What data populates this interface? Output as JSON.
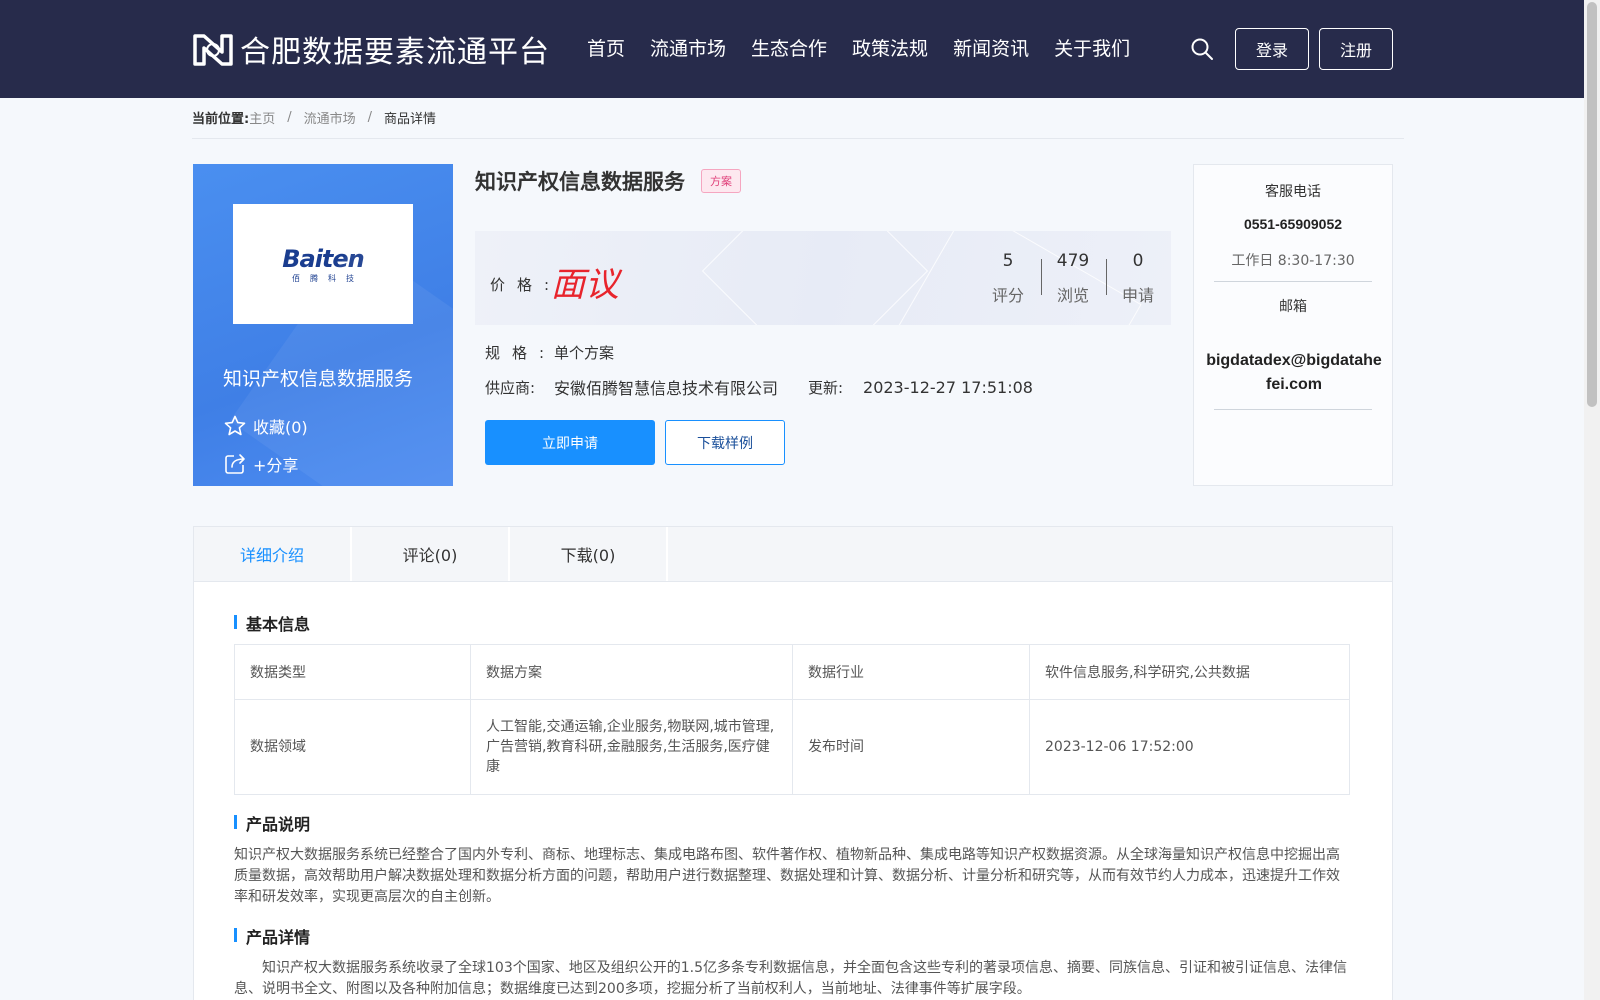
{
  "header": {
    "site_title": "合肥数据要素流通平台",
    "nav": [
      "首页",
      "流通市场",
      "生态合作",
      "政策法规",
      "新闻资讯",
      "关于我们"
    ],
    "login_label": "登录",
    "register_label": "注册",
    "logo_icon": "platform-logo-icon",
    "search_icon": "search-icon"
  },
  "breadcrumb": {
    "label": "当前位置:",
    "items": [
      "主页",
      "流通市场"
    ],
    "current": "商品详情",
    "separator": "/"
  },
  "product": {
    "title": "知识产权信息数据服务",
    "tag": "方案",
    "logo_text": "Baiten",
    "logo_sub": "佰腾科技",
    "card_name": "知识产权信息数据服务",
    "favorite_label": "收藏(0)",
    "share_label": "+分享",
    "price_label": "价格:",
    "price_value": "面议",
    "stats": [
      {
        "num": "5",
        "label": "评分"
      },
      {
        "num": "479",
        "label": "浏览"
      },
      {
        "num": "0",
        "label": "申请"
      }
    ],
    "spec_label": "规格:",
    "spec_value": "单个方案",
    "supplier_label": "供应商:",
    "supplier_value": "安徽佰腾智慧信息技术有限公司",
    "update_label": "更新:",
    "update_value": "2023-12-27 17:51:08",
    "apply_label": "立即申请",
    "sample_label": "下载样例"
  },
  "contact": {
    "phone_label": "客服电话",
    "phone": "0551-65909052",
    "hours": "工作日 8:30-17:30",
    "email_label": "邮箱",
    "email": "bigdatadex@bigdatahefei.com"
  },
  "tabs": [
    {
      "label": "详细介绍",
      "active": true
    },
    {
      "label": "评论(0)",
      "active": false
    },
    {
      "label": "下载(0)",
      "active": false
    }
  ],
  "basic_info": {
    "title": "基本信息",
    "rows": [
      [
        "数据类型",
        "数据方案",
        "数据行业",
        "软件信息服务,科学研究,公共数据"
      ],
      [
        "数据领域",
        "人工智能,交通运输,企业服务,物联网,城市管理,广告营销,教育科研,金融服务,生活服务,医疗健康",
        "发布时间",
        "2023-12-06 17:52:00"
      ]
    ]
  },
  "description": {
    "title": "产品说明",
    "text": "知识产权大数据服务系统已经整合了国内外专利、商标、地理标志、集成电路布图、软件著作权、植物新品种、集成电路等知识产权数据资源。从全球海量知识产权信息中挖掘出高质量数据，高效帮助用户解决数据处理和数据分析方面的问题，帮助用户进行数据整理、数据处理和计算、数据分析、计量分析和研究等，从而有效节约人力成本，迅速提升工作效率和研发效率，实现更高层次的自主创新。"
  },
  "details": {
    "title": "产品详情",
    "text": "知识产权大数据服务系统收录了全球103个国家、地区及组织公开的1.5亿多条专利数据信息，并全面包含这些专利的著录项信息、摘要、同族信息、引证和被引证信息、法律信息、说明书全文、附图以及各种附加信息；数据维度已达到200多项，挖掘分析了当前权利人，当前地址、法律事件等扩展字段。"
  },
  "colors": {
    "header_bg": "#272b4b",
    "accent": "#1890ff",
    "price": "#e8242c",
    "card_bg": "#4a8ff0"
  }
}
